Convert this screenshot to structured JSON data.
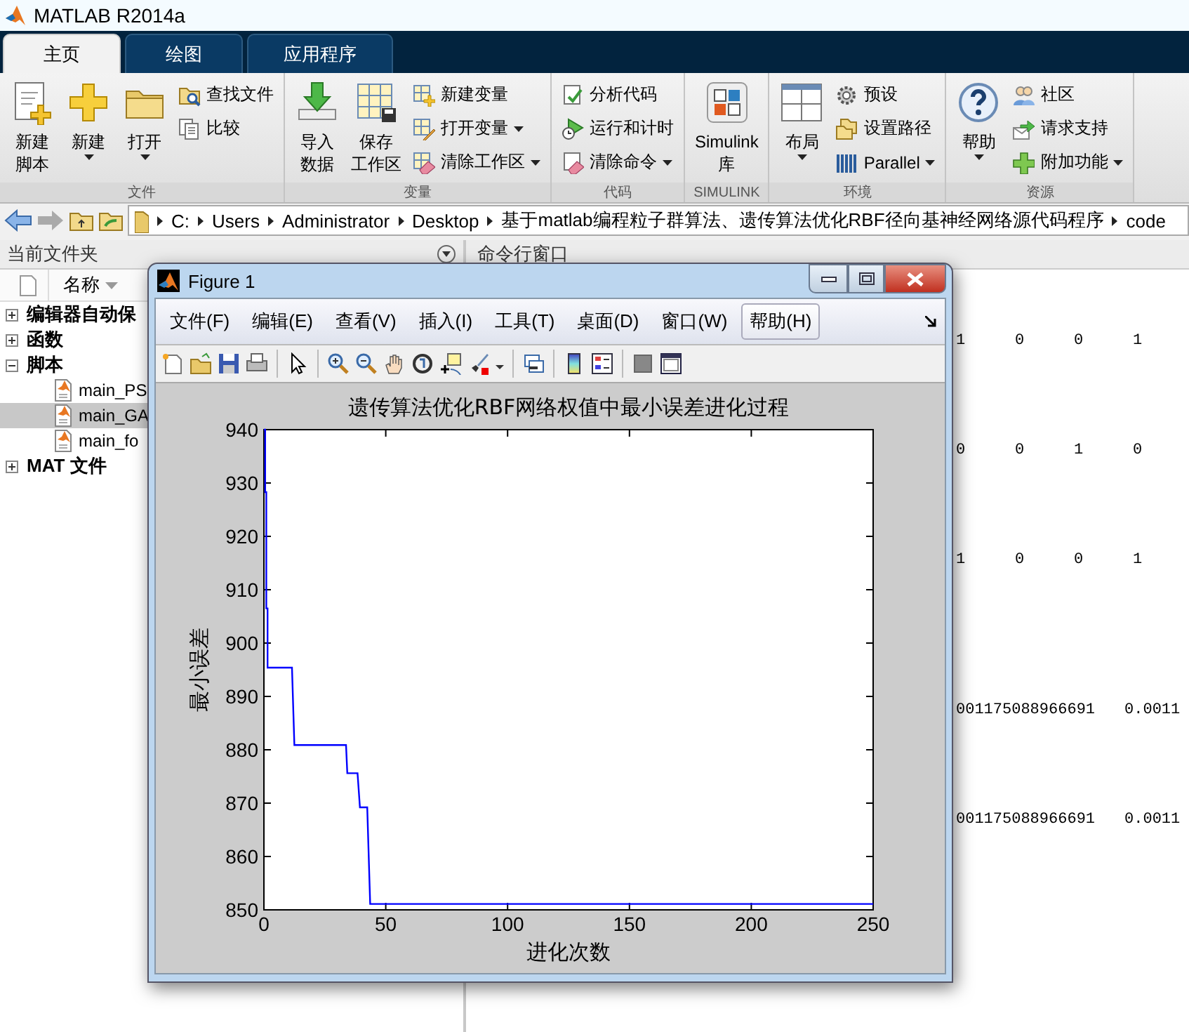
{
  "window": {
    "title": "MATLAB R2014a"
  },
  "tabs": [
    {
      "label": "主页",
      "selected": true
    },
    {
      "label": "绘图",
      "selected": false
    },
    {
      "label": "应用程序",
      "selected": false
    }
  ],
  "ribbon": {
    "groups": [
      {
        "label": "文件",
        "items": [
          {
            "kind": "large",
            "lines": [
              "新建",
              "脚本"
            ],
            "dropdown": false
          },
          {
            "kind": "large",
            "lines": [
              "新建"
            ],
            "dropdown": true
          },
          {
            "kind": "large",
            "lines": [
              "打开"
            ],
            "dropdown": true
          },
          {
            "kind": "stack",
            "items": [
              {
                "label": "查找文件",
                "dropdown": false
              },
              {
                "label": "比较",
                "dropdown": false
              }
            ]
          }
        ]
      },
      {
        "label": "变量",
        "items": [
          {
            "kind": "large",
            "lines": [
              "导入",
              "数据"
            ],
            "dropdown": false
          },
          {
            "kind": "large",
            "lines": [
              "保存",
              "工作区"
            ],
            "dropdown": false
          },
          {
            "kind": "stack",
            "items": [
              {
                "label": "新建变量",
                "dropdown": false
              },
              {
                "label": "打开变量",
                "dropdown": true
              },
              {
                "label": "清除工作区",
                "dropdown": true
              }
            ]
          }
        ]
      },
      {
        "label": "代码",
        "items": [
          {
            "kind": "stack",
            "items": [
              {
                "label": "分析代码",
                "dropdown": false
              },
              {
                "label": "运行和计时",
                "dropdown": false
              },
              {
                "label": "清除命令",
                "dropdown": true
              }
            ]
          }
        ]
      },
      {
        "label": "SIMULINK",
        "items": [
          {
            "kind": "large",
            "lines": [
              "Simulink",
              "库"
            ],
            "dropdown": false
          }
        ]
      },
      {
        "label": "环境",
        "items": [
          {
            "kind": "large",
            "lines": [
              "布局"
            ],
            "dropdown": true
          },
          {
            "kind": "stack",
            "items": [
              {
                "label": "预设",
                "dropdown": false
              },
              {
                "label": "设置路径",
                "dropdown": false
              },
              {
                "label": "Parallel",
                "dropdown": true
              }
            ]
          }
        ]
      },
      {
        "label": "资源",
        "items": [
          {
            "kind": "large",
            "lines": [
              "帮助"
            ],
            "dropdown": true
          },
          {
            "kind": "stack",
            "items": [
              {
                "label": "社区",
                "dropdown": false
              },
              {
                "label": "请求支持",
                "dropdown": false
              },
              {
                "label": "附加功能",
                "dropdown": true
              }
            ]
          }
        ]
      }
    ]
  },
  "address_bar": {
    "crumbs": [
      "C:",
      "Users",
      "Administrator",
      "Desktop",
      "基于matlab编程粒子群算法、遗传算法优化RBF径向基神经网络源代码程序",
      "code"
    ]
  },
  "file_panel": {
    "title": "当前文件夹",
    "column": "名称",
    "tree": [
      {
        "label": "编辑器自动保",
        "expanded": false,
        "selected": false
      },
      {
        "label": "函数",
        "expanded": false,
        "selected": false
      },
      {
        "label": "脚本",
        "expanded": true,
        "selected": false,
        "children": [
          {
            "label": "main_PS",
            "selected": false
          },
          {
            "label": "main_GA",
            "selected": true
          },
          {
            "label": "main_fo",
            "selected": false
          }
        ]
      },
      {
        "label": "MAT 文件",
        "expanded": false,
        "selected": false
      }
    ]
  },
  "command_window": {
    "title": "命令行窗口",
    "blocks": [
      {
        "rows": [
          [
            "1",
            "0",
            "0",
            "1"
          ],
          [
            "0",
            "0",
            "1",
            "0"
          ],
          [
            "1",
            "0",
            "0",
            "1"
          ]
        ]
      },
      {
        "rows": [
          [
            "001175088966691",
            "0.0011"
          ],
          [
            "001175088966691",
            "0.0011"
          ]
        ]
      }
    ]
  },
  "figure": {
    "title": "Figure 1",
    "menu": [
      {
        "label": "文件(F)",
        "selected": false
      },
      {
        "label": "编辑(E)",
        "selected": false
      },
      {
        "label": "查看(V)",
        "selected": false
      },
      {
        "label": "插入(I)",
        "selected": false
      },
      {
        "label": "工具(T)",
        "selected": false
      },
      {
        "label": "桌面(D)",
        "selected": false
      },
      {
        "label": "窗口(W)",
        "selected": false
      },
      {
        "label": "帮助(H)",
        "selected": true
      }
    ],
    "chart_data": {
      "type": "line",
      "title": "遗传算法优化RBF网络权值中最小误差进化过程",
      "xlabel": "进化次数",
      "ylabel": "最小误差",
      "x": [
        0,
        0.5,
        0.5,
        1,
        1,
        1.5,
        1.5,
        11.5,
        12.5,
        33.7,
        34.2,
        38.4,
        39.4,
        42.4,
        43.6,
        250
      ],
      "series": [
        {
          "color": "#0000ff",
          "values": [
            940,
            940,
            928.3,
            928.3,
            906.5,
            906.5,
            895.4,
            895.4,
            880.9,
            880.9,
            875.6,
            875.6,
            869.2,
            869.2,
            851.1,
            851.1
          ]
        }
      ],
      "xlim": [
        0,
        250
      ],
      "ylim": [
        850,
        940
      ],
      "xticks": [
        0,
        50,
        100,
        150,
        200,
        250
      ],
      "yticks": [
        850,
        860,
        870,
        880,
        890,
        900,
        910,
        920,
        930,
        940
      ]
    }
  }
}
